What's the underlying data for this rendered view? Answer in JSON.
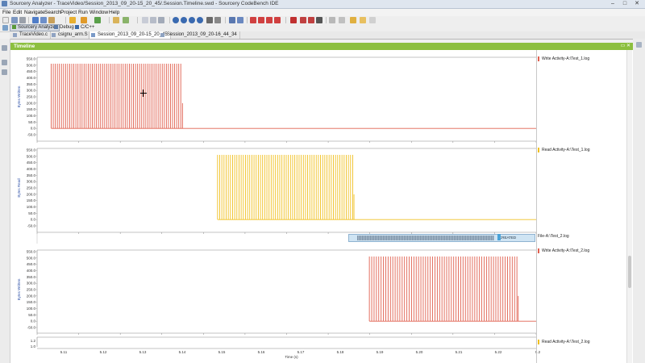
{
  "window": {
    "title": "Sourcery Analyzer - TraceVideo/Session_2013_09_20-15_20_45/.Session.Timeline.swd - Sourcery CodeBench IDE",
    "minimize": "–",
    "maximize": "□",
    "close": "✕"
  },
  "menu": [
    "File",
    "Edit",
    "Navigate",
    "Search",
    "Project",
    "Run",
    "Window",
    "Help"
  ],
  "perspectives": [
    {
      "label": "Sourcery Analyzer",
      "active": true
    },
    {
      "label": "Debug",
      "active": false
    },
    {
      "label": "C/C++",
      "active": false
    }
  ],
  "tabs": [
    {
      "label": "TraceVideo.c",
      "active": false
    },
    {
      "label": "csignu_arm.S",
      "active": false
    },
    {
      "label": "Session_2013_09_20-15_20_45",
      "active": true
    },
    {
      "label": "Session_2013_09_20-16_44_34",
      "active": false
    }
  ],
  "view": {
    "title": "Timeline",
    "buttons": "▭ ✕"
  },
  "icons": {
    "crosshair": "crosshair-cursor-icon",
    "perspective_analyzer": "analyzer-icon",
    "perspective_debug": "bug-icon",
    "perspective_cpp": "cpp-icon"
  },
  "colors": {
    "write_trace": "#e0604f",
    "read_trace": "#f0c020",
    "view_header": "#8cbf3f",
    "state_bar": "#cfe4f3"
  },
  "chart_data": [
    {
      "type": "bar",
      "title": "",
      "ylabel": "Bytes Written",
      "legend": "Write Activity-A:\\Test_1.log",
      "color": "#e0604f",
      "yticks": [
        "550.0",
        "500.0",
        "450.0",
        "400.0",
        "350.0",
        "300.0",
        "250.0",
        "200.0",
        "150.0",
        "100.0",
        "50.0",
        "0.0",
        "-50.0"
      ],
      "ylim": [
        -50,
        550
      ],
      "bursts": {
        "x_start": 5.1098,
        "x_end": 5.1401,
        "count": 64,
        "value": 512,
        "tail_x": 5.1405,
        "tail_value": 200
      }
    },
    {
      "type": "bar",
      "title": "",
      "ylabel": "Bytes Read",
      "legend": "Read Activity-A:\\Test_1.log",
      "color": "#f0c020",
      "yticks": [
        "550.0",
        "500.0",
        "450.0",
        "400.0",
        "350.0",
        "300.0",
        "250.0",
        "200.0",
        "150.0",
        "100.0",
        "50.0",
        "0.0",
        "-50.0"
      ],
      "ylim": [
        -50,
        550
      ],
      "bursts": {
        "x_start": 5.1487,
        "x_end": 5.1803,
        "count": 64,
        "value": 512,
        "tail_x": 5.1806,
        "tail_value": 200
      }
    },
    {
      "type": "state",
      "legend": "File-A:\\Test_2.log",
      "state_label": "CREATED"
    },
    {
      "type": "bar",
      "title": "",
      "ylabel": "Bytes Written",
      "legend": "Write Activity-A:\\Test_2.log",
      "color": "#e0604f",
      "yticks": [
        "550.0",
        "500.0",
        "450.0",
        "400.0",
        "350.0",
        "300.0",
        "250.0",
        "200.0",
        "150.0",
        "100.0",
        "50.0",
        "0.0",
        "-50.0"
      ],
      "ylim": [
        -50,
        550
      ],
      "bursts": {
        "x_start": 5.1842,
        "x_end": 5.2187,
        "count": 64,
        "value": 512,
        "tail_x": 5.219,
        "tail_value": 200
      }
    },
    {
      "type": "bar",
      "title": "",
      "legend": "Read Activity-A:\\Test_2.log",
      "color": "#f0c020",
      "yticks": [
        "1.2",
        "1.0"
      ]
    }
  ],
  "x_axis": {
    "label": "Time (s)",
    "ticks": [
      "5.11",
      "5.12",
      "5.13",
      "5.14",
      "5.15",
      "5.16",
      "5.17",
      "5.18",
      "5.19",
      "5.20",
      "5.21",
      "5.22",
      "5.2"
    ],
    "range": [
      5.1065,
      5.2232
    ]
  }
}
